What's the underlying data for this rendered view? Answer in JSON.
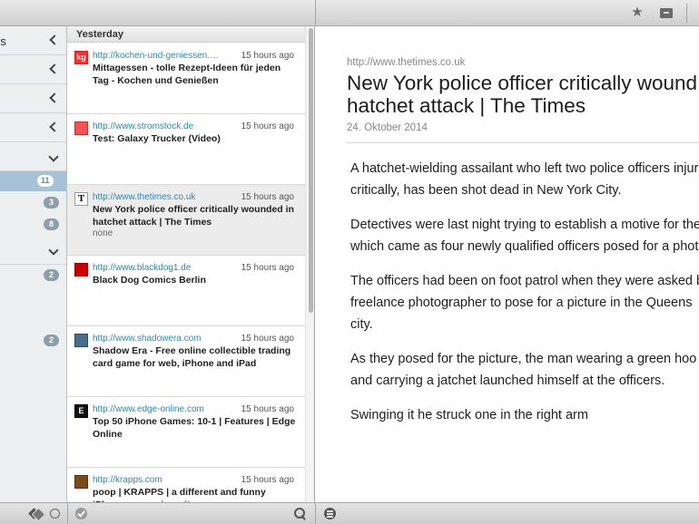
{
  "toolbar": {
    "icons": [
      "star-icon",
      "archive-icon"
    ]
  },
  "sidebar": {
    "partial_label": "rs",
    "badges": [
      "11",
      "3",
      "8",
      "2",
      "2"
    ]
  },
  "list": {
    "section": "Yesterday",
    "items": [
      {
        "url": "http://kochen-und-geniessen.lec...",
        "time": "15 hours ago",
        "title": "Mittagessen - tolle Rezept-Ideen für jeden Tag - Kochen und Genießen",
        "icon": "kg"
      },
      {
        "url": "http://www.stromstock.de",
        "time": "15 hours ago",
        "title": "Test: Galaxy Trucker (Video)",
        "icon": ""
      },
      {
        "url": "http://www.thetimes.co.uk",
        "time": "15 hours ago",
        "title": "New York police officer critically wounded in hatchet attack | The Times",
        "note": "none",
        "icon": "T"
      },
      {
        "url": "http://www.blackdog1.de",
        "time": "15 hours ago",
        "title": "Black Dog Comics Berlin",
        "icon": ""
      },
      {
        "url": "http://www.shadowera.com",
        "time": "15 hours ago",
        "title": "Shadow Era - Free online collectible trading card game for web, iPhone and iPad",
        "icon": ""
      },
      {
        "url": "http://www.edge-online.com",
        "time": "15 hours ago",
        "title": "Top 50 iPhone Games: 10-1 | Features | Edge Online",
        "icon": "E"
      },
      {
        "url": "http://krapps.com",
        "time": "15 hours ago",
        "title": "poop | KRAPPS | a different and funny iPhone app review site",
        "icon": ""
      }
    ]
  },
  "article": {
    "source": "http://www.thetimes.co.uk",
    "title_line1": "New York police officer critically wound",
    "title_line2": "hatchet attack | The Times",
    "date": "24. Oktober 2014",
    "p1_l1": "A hatchet-wielding assailant who left two police officers injur",
    "p1_l2": "critically, has been shot dead in New York City.",
    "p2_l1": "Detectives were last night trying to establish a motive for the",
    "p2_l2": "which came as four newly qualified officers posed for a photo",
    "p3_l1": "The officers had been on foot patrol when they were asked b",
    "p3_l2": "freelance photographer to pose for a picture in the Queens",
    "p3_l3": "city.",
    "p4_l1": "As they posed for the picture, the man wearing a green hoo",
    "p4_l2": "and carrying a jatchet launched himself at the officers.",
    "p5_l1": "Swinging it he struck one in the right arm"
  }
}
